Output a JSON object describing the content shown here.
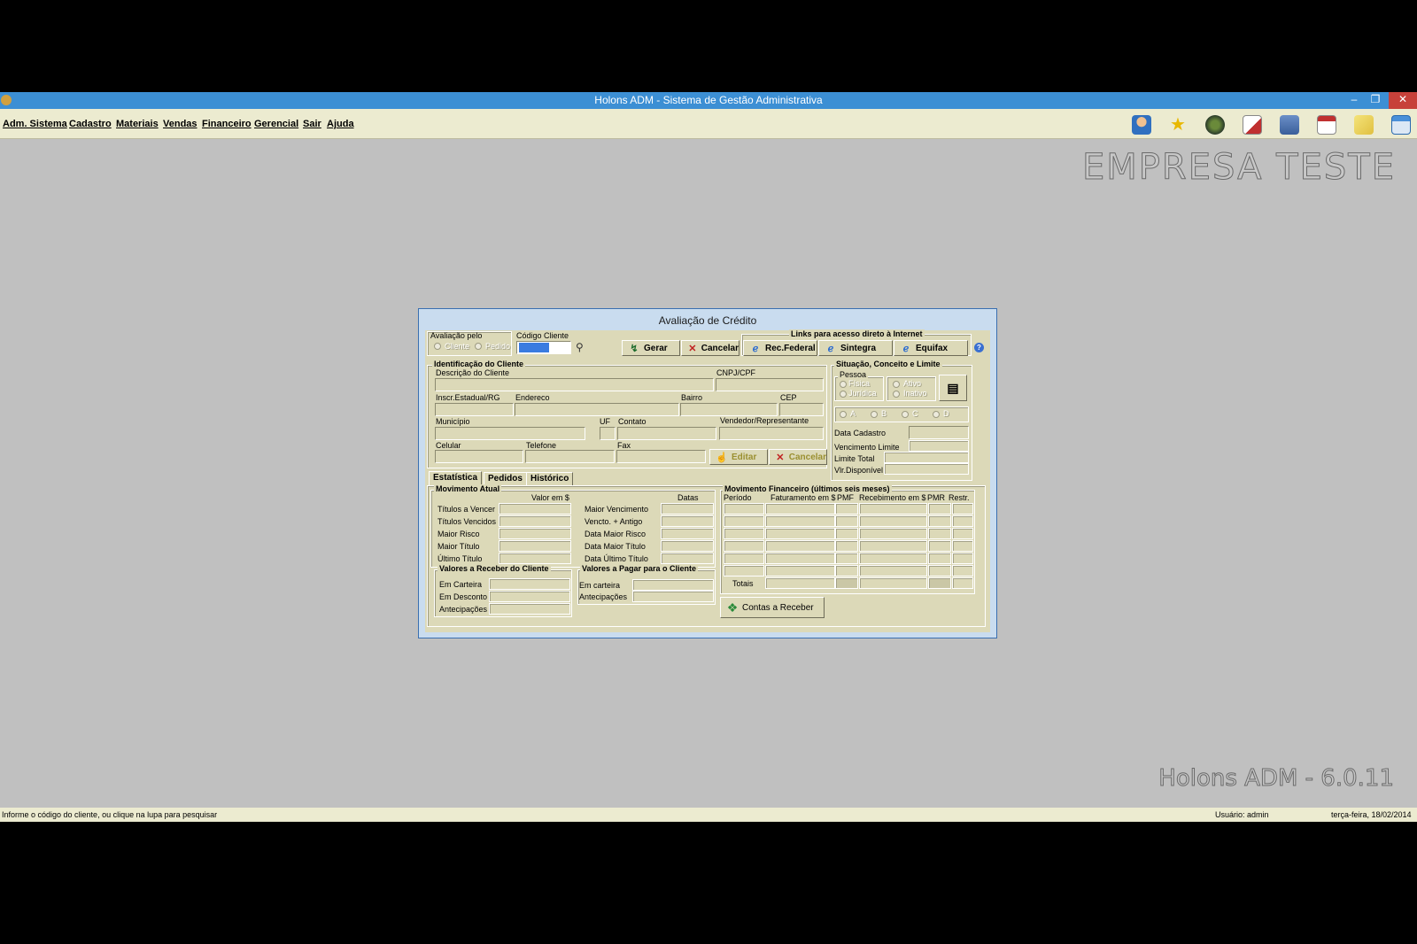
{
  "window": {
    "title": "Holons ADM - Sistema de Gestão Administrativa",
    "min": "–",
    "max": "❐",
    "close": "✕"
  },
  "menu": [
    {
      "label": "Adm. Sistema"
    },
    {
      "label": "Cadastro"
    },
    {
      "label": "Materiais"
    },
    {
      "label": "Vendas"
    },
    {
      "label": "Financeiro"
    },
    {
      "label": "Gerencial"
    },
    {
      "label": "Sair"
    },
    {
      "label": "Ajuda"
    }
  ],
  "toolbar_icons": [
    "user-icon",
    "star-icon",
    "globe-icon",
    "notepad-icon",
    "stack-icon",
    "calendar-icon",
    "notes-icon",
    "window-icon"
  ],
  "brand": "EMPRESA TESTE",
  "version": "Holons ADM - 6.0.11",
  "status": {
    "message": "Informe o código do cliente, ou clique na lupa para pesquisar",
    "user": "Usuário: admin",
    "date": "terça-feira, 18/02/2014"
  },
  "dialog": {
    "title": "Avaliação de Crédito",
    "avaliacao": {
      "label": "Avaliação pelo",
      "opt_cliente": "Cliente",
      "opt_pedido": "Pedido"
    },
    "codigo": {
      "label": "Código Cliente",
      "value": ""
    },
    "buttons": {
      "gerar": "Gerar",
      "cancelar": "Cancelar",
      "editar": "Editar",
      "cancelar2": "Cancelar",
      "contas": "Contas a Receber"
    },
    "links": {
      "label": "Links para acesso direto à Internet",
      "rec_federal": "Rec.Federal",
      "sintegra": "Sintegra",
      "equifax": "Equifax",
      "help": "?"
    },
    "ident": {
      "label": "Identificação do Cliente",
      "descricao": "Descrição do Cliente",
      "cnpj": "CNPJ/CPF",
      "inscr": "Inscr.Estadual/RG",
      "endereco": "Endereco",
      "bairro": "Bairro",
      "cep": "CEP",
      "municipio": "Município",
      "uf": "UF",
      "contato": "Contato",
      "vendedor": "Vendedor/Representante",
      "celular": "Celular",
      "telefone": "Telefone",
      "fax": "Fax"
    },
    "situacao": {
      "label": "Situação, Conceito e Limite",
      "pessoa": "Pessoa",
      "fisica": "Física",
      "juridica": "Jurídica",
      "ativo": "Ativo",
      "inativo": "Inativo",
      "conceitos": [
        "A",
        "B",
        "C",
        "D"
      ],
      "data_cadastro": "Data Cadastro",
      "vencimento_limite": "Vencimento Limite",
      "limite_total": "Limite Total",
      "vlr_disponivel": "Vlr.Disponível"
    },
    "tabs": [
      "Estatística",
      "Pedidos",
      "Histórico"
    ],
    "movimento": {
      "label": "Movimento Atual",
      "valor_header": "Valor em $",
      "datas_header": "Datas",
      "left_rows": [
        "Títulos a Vencer",
        "Títulos Vencidos",
        "Maior Risco",
        "Maior Título",
        "Último Título"
      ],
      "right_rows": [
        "Maior Vencimento",
        "Vencto. + Antigo",
        "Data Maior Risco",
        "Data Maior Título",
        "Data Último Título"
      ]
    },
    "receber": {
      "label": "Valores a Receber do Cliente",
      "rows": [
        "Em Carteira",
        "Em Desconto",
        "Antecipações"
      ]
    },
    "pagar": {
      "label": "Valores a Pagar para o Cliente",
      "rows": [
        "Em carteira",
        "Antecipações"
      ]
    },
    "financeiro": {
      "label": "Movimento Financeiro (últimos seis meses)",
      "headers": [
        "Período",
        "Faturamento em $",
        "PMF",
        "Recebimento em $",
        "PMR",
        "Restr."
      ],
      "totais": "Totais"
    }
  }
}
